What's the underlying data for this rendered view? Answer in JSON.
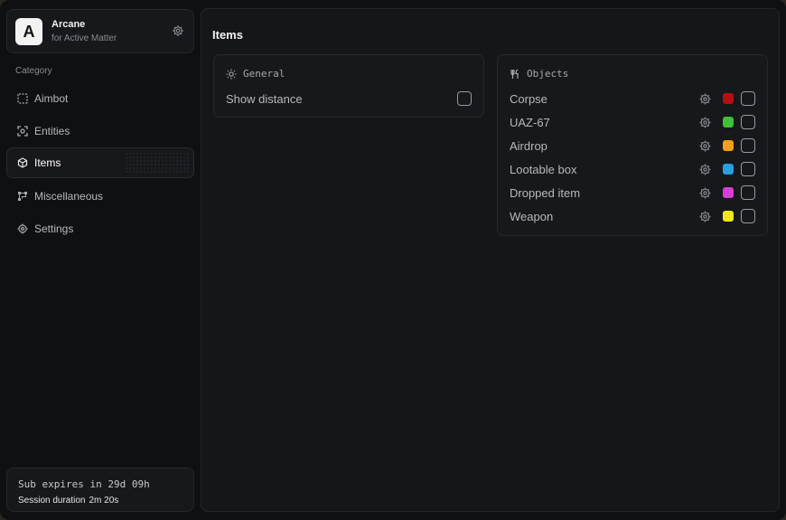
{
  "brand": {
    "logo": "A",
    "title": "Arcane",
    "subtitle": "for Active Matter",
    "icon": "gear-icon"
  },
  "sidebar": {
    "category_label": "Category",
    "items": [
      {
        "label": "Aimbot",
        "icon": "crosshair-frame-icon",
        "active": false
      },
      {
        "label": "Entities",
        "icon": "scan-target-icon",
        "active": false
      },
      {
        "label": "Items",
        "icon": "box-icon",
        "active": true
      },
      {
        "label": "Miscellaneous",
        "icon": "workflow-icon",
        "active": false
      },
      {
        "label": "Settings",
        "icon": "gear-icon",
        "active": false
      }
    ]
  },
  "subscription": {
    "expires_text": "Sub expires in 29d 09h",
    "session_label": "Session duration",
    "session_value": "2m 20s"
  },
  "main": {
    "title": "Items",
    "general": {
      "title": "General",
      "icon": "settings-sun-icon",
      "rows": [
        {
          "label": "Show distance",
          "checked": false
        }
      ]
    },
    "objects": {
      "title": "Objects",
      "icon": "utensils-icon",
      "rows": [
        {
          "label": "Corpse",
          "color": "#b5100f",
          "checked": false
        },
        {
          "label": "UAZ-67",
          "color": "#3fbf3a",
          "checked": false
        },
        {
          "label": "Airdrop",
          "color": "#f29d1c",
          "checked": false
        },
        {
          "label": "Lootable box",
          "color": "#2a9de0",
          "checked": false
        },
        {
          "label": "Dropped item",
          "color": "#d63fd6",
          "checked": false
        },
        {
          "label": "Weapon",
          "color": "#f2e61a",
          "checked": false
        }
      ]
    }
  },
  "colors": {
    "background": "#0f1012",
    "panel": "#151619",
    "card": "#17181b"
  }
}
